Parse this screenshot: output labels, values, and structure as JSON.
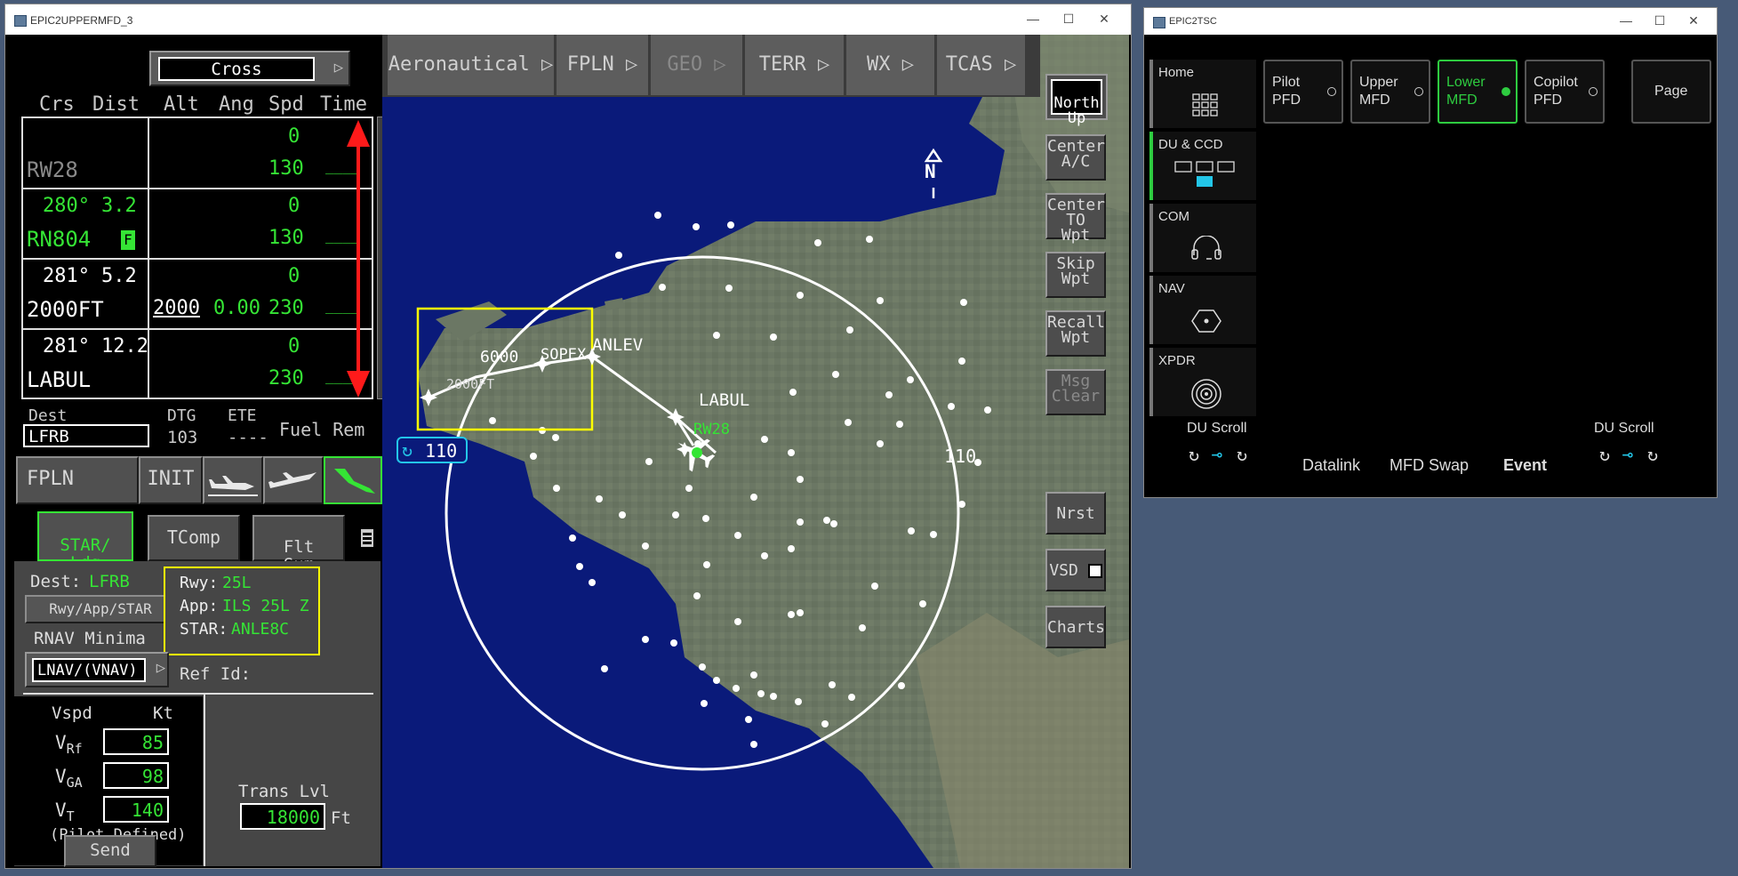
{
  "mfd": {
    "title": "EPIC2UPPERMFD_3",
    "cross_label": "Cross",
    "columns": [
      "Crs",
      "Dist",
      "Alt",
      "Ang",
      "Spd",
      "Time"
    ],
    "fp_rows": [
      {
        "crs": "",
        "dist": "",
        "ident": "RW28",
        "alt": "",
        "ang": "0",
        "spd": "130",
        "time": "____"
      },
      {
        "crs": "280°",
        "dist": "3.2",
        "ident": "RN804",
        "flag": "F",
        "alt": "",
        "ang": "0",
        "spd": "130",
        "time": "____"
      },
      {
        "crs": "281°",
        "dist": "5.2",
        "ident": "2000FT",
        "alt": "2000",
        "ang": "0.00",
        "angtop": "0",
        "spd": "230",
        "time": "____"
      },
      {
        "crs": "281°",
        "dist": "12.2",
        "ident": "LABUL",
        "alt": "",
        "ang": "0",
        "spd": "230",
        "time": "____"
      }
    ],
    "dest_label": "Dest",
    "dest_value": "LFRB",
    "dtg_label": "DTG",
    "dtg_value": "103",
    "ete_label": "ETE",
    "ete_value": "----",
    "fuel_label": "Fuel Rem",
    "fpln_btn": "FPLN",
    "init_btn": "INIT",
    "tabs": {
      "star": "STAR/\nLdg",
      "tcomp": "TComp",
      "flt": "Flt\nSum"
    },
    "dest2_label": "Dest:",
    "dest2_value": "LFRB",
    "rwy_app_star_btn": "Rwy/App/STAR",
    "rnav_label": "RNAV Minima",
    "lnav_value": "LNAV/(VNAV)",
    "rwy_label": "Rwy:",
    "rwy_value": "25L",
    "app_label": "App:",
    "app_value": "ILS 25L Z",
    "star_label": "STAR:",
    "star_value": "ANLE8C",
    "refid_label": "Ref Id:",
    "vspd_label": "Vspd",
    "kt_label": "Kt",
    "vrf_label": "V",
    "vrf_sub": "Rf",
    "vrf_value": "85",
    "vga_label": "V",
    "vga_sub": "GA",
    "vga_value": "98",
    "vt_label": "V",
    "vt_sub": "T",
    "vt_value": "140",
    "pilot_defined": "(Pilot Defined)",
    "send_btn": "Send",
    "trans_label": "Trans Lvl",
    "trans_value": "18000",
    "ft_label": "Ft"
  },
  "map": {
    "tabs": [
      {
        "label": "Aeronautical",
        "enabled": true
      },
      {
        "label": "FPLN",
        "enabled": true
      },
      {
        "label": "GEO",
        "enabled": false
      },
      {
        "label": "TERR",
        "enabled": true
      },
      {
        "label": "WX",
        "enabled": true
      },
      {
        "label": "TCAS",
        "enabled": true
      }
    ],
    "side_buttons": [
      {
        "label": "Center\nA/C",
        "enabled": true
      },
      {
        "label": "Center\nTO Wpt",
        "enabled": true
      },
      {
        "label": "Skip\nWpt",
        "enabled": true
      },
      {
        "label": "Recall\nWpt",
        "enabled": true
      },
      {
        "label": "Msg\nClear",
        "enabled": false
      }
    ],
    "north_up": "North\nUp",
    "nrst_btn": "Nrst",
    "vsd_btn": "VSD",
    "charts_btn": "Charts",
    "range_label": "110",
    "range_ring_label": "110",
    "north_label": "N",
    "waypoints": [
      "ANLEV",
      "SOPEX",
      "LABUL",
      "6000",
      "2000FT",
      "RW28"
    ],
    "colors": {
      "water": "#0a1a7a",
      "land": "#6e7a64",
      "route": "#ffffff",
      "box": "#ffff00"
    }
  },
  "tsc": {
    "title": "EPIC2TSC",
    "side": [
      {
        "label": "Home",
        "icon": "grid-icon"
      },
      {
        "label": "DU & CCD",
        "icon": "display-units-icon"
      },
      {
        "label": "COM",
        "icon": "headset-icon"
      },
      {
        "label": "NAV",
        "icon": "nav-beacon-icon"
      },
      {
        "label": "XPDR",
        "icon": "transponder-icon"
      }
    ],
    "top": [
      {
        "label": "Pilot\nPFD",
        "active": false
      },
      {
        "label": "Upper\nMFD",
        "active": false
      },
      {
        "label": "Lower\nMFD",
        "active": true
      },
      {
        "label": "Copilot\nPFD",
        "active": false
      }
    ],
    "page_btn": "Page",
    "du_scroll_left": "DU Scroll",
    "du_scroll_right": "DU Scroll",
    "datalink": "Datalink",
    "mfd_swap": "MFD Swap",
    "event": "Event"
  }
}
